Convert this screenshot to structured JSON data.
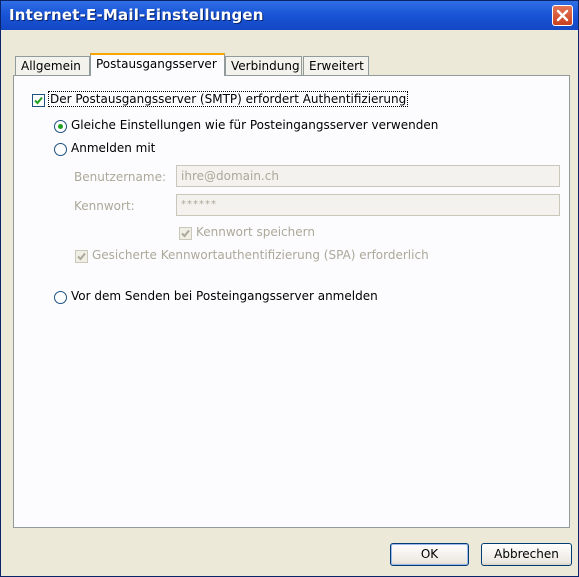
{
  "window": {
    "title": "Internet-E-Mail-Einstellungen"
  },
  "tabs": [
    {
      "label": "Allgemein"
    },
    {
      "label": "Postausgangsserver"
    },
    {
      "label": "Verbindung"
    },
    {
      "label": "Erweitert"
    }
  ],
  "smtp_auth": {
    "label": "Der Postausgangsserver (SMTP) erfordert Authentifizierung",
    "checked": true
  },
  "options": {
    "same_settings": "Gleiche Einstellungen wie für Posteingangsserver verwenden",
    "login_with": "Anmelden mit",
    "login_before_send": "Vor dem Senden bei Posteingangsserver anmelden"
  },
  "login": {
    "username_label": "Benutzername:",
    "username_value": "ihre@domain.ch",
    "password_label": "Kennwort:",
    "password_value": "******",
    "save_password": "Kennwort speichern",
    "spa_required": "Gesicherte Kennwortauthentifizierung (SPA) erforderlich"
  },
  "buttons": {
    "ok": "OK",
    "cancel": "Abbrechen"
  }
}
